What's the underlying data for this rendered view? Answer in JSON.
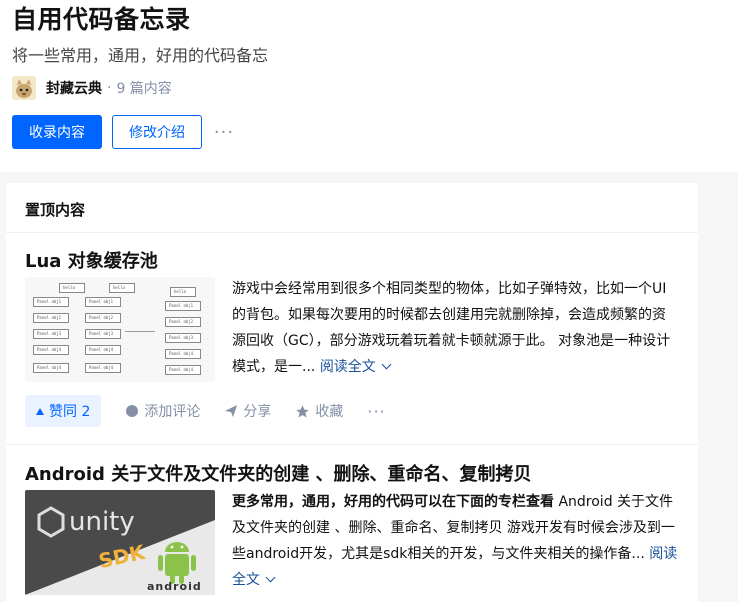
{
  "column": {
    "title": "自用代码备忘录",
    "description": "将一些常用，通用，好用的代码备忘",
    "author": "封藏云典",
    "separator": "·",
    "count": "9 篇内容"
  },
  "buttons": {
    "collect": "收录内容",
    "edit_intro": "修改介绍",
    "more": "···"
  },
  "pinned": {
    "heading": "置顶内容",
    "items": [
      {
        "title": "Lua 对象缓存池",
        "excerpt": "游戏中会经常用到很多个相同类型的物体，比如子弹特效，比如一个UI的背包。如果每次要用的时候都去创建用完就删除掉，会造成频繁的资源回收（GC），部分游戏玩着玩着就卡顿就源于此。 对象池是一种设计模式，是一...",
        "read_more": "阅读全文",
        "thumb_labels": [
          "hello",
          "Panel obj1",
          "Panel obj2",
          "Panel obj3",
          "Panel obj4"
        ],
        "actions": {
          "vote": "赞同 2",
          "comment": "添加评论",
          "share": "分享",
          "favorite": "收藏",
          "more": "···"
        }
      },
      {
        "title": "Android 关于文件及文件夹的创建 、删除、重命名、复制拷贝",
        "excerpt_bold": "更多常用，通用，好用的代码可以在下面的专栏查看",
        "excerpt": " Android 关于文件及文件夹的创建 、删除、重命名、复制拷贝 游戏开发有时候会涉及到一些android开发，尤其是sdk相关的开发，与文件夹相关的操作备...",
        "read_more": "阅读全文",
        "thumb_labels": {
          "unity": "unity",
          "sdk": "SDK",
          "android": "android"
        }
      }
    ]
  },
  "colors": {
    "accent": "#0066ff",
    "link": "#175199",
    "muted": "#8590a6"
  }
}
